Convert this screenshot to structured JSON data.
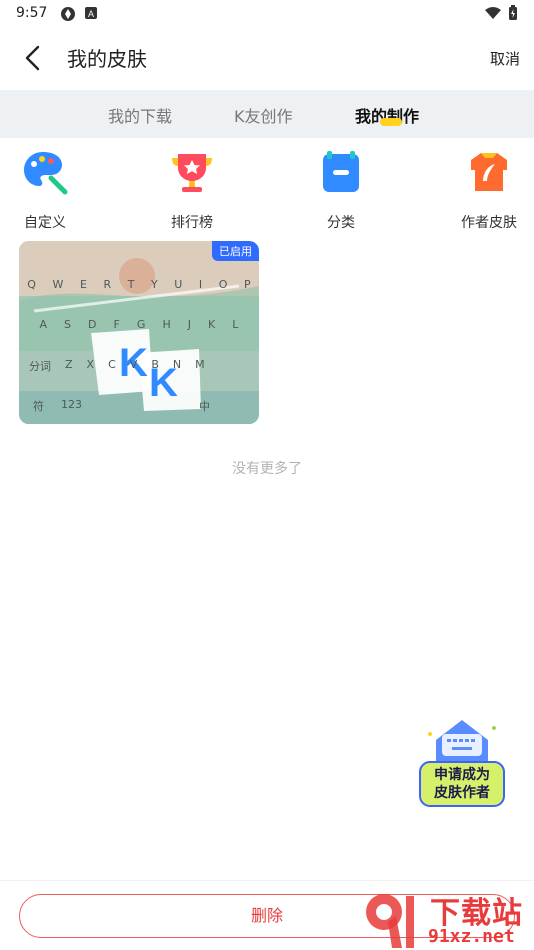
{
  "status_bar": {
    "time": "9:57"
  },
  "header": {
    "title": "我的皮肤",
    "cancel_label": "取消"
  },
  "tabs": [
    {
      "label": "我的下载",
      "active": false
    },
    {
      "label": "K友创作",
      "active": false
    },
    {
      "label": "我的制作",
      "active": true
    }
  ],
  "shortcuts": [
    {
      "label": "自定义",
      "icon": "palette-icon"
    },
    {
      "label": "排行榜",
      "icon": "trophy-icon"
    },
    {
      "label": "分类",
      "icon": "category-icon"
    },
    {
      "label": "作者皮肤",
      "icon": "author-skin-icon"
    }
  ],
  "skin_card": {
    "badge": "已启用",
    "rows": [
      [
        "Q",
        "W",
        "E",
        "R",
        "T",
        "Y",
        "U",
        "I",
        "O",
        "P"
      ],
      [
        "A",
        "S",
        "D",
        "F",
        "G",
        "H",
        "J",
        "K",
        "L"
      ],
      [
        "分词",
        "Z",
        "X",
        "C",
        "V",
        "B",
        "N",
        "M"
      ],
      [
        "符",
        "123",
        "中"
      ]
    ]
  },
  "list_end_text": "没有更多了",
  "author_badge": {
    "line1": "申请成为",
    "line2": "皮肤作者"
  },
  "bottom": {
    "delete_label": "删除"
  },
  "watermark": {
    "text1": "下载站",
    "text2": "91xz.net"
  },
  "colors": {
    "accent": "#ffd21f",
    "danger": "#e83b3b",
    "badge_blue": "#2f6bff"
  }
}
